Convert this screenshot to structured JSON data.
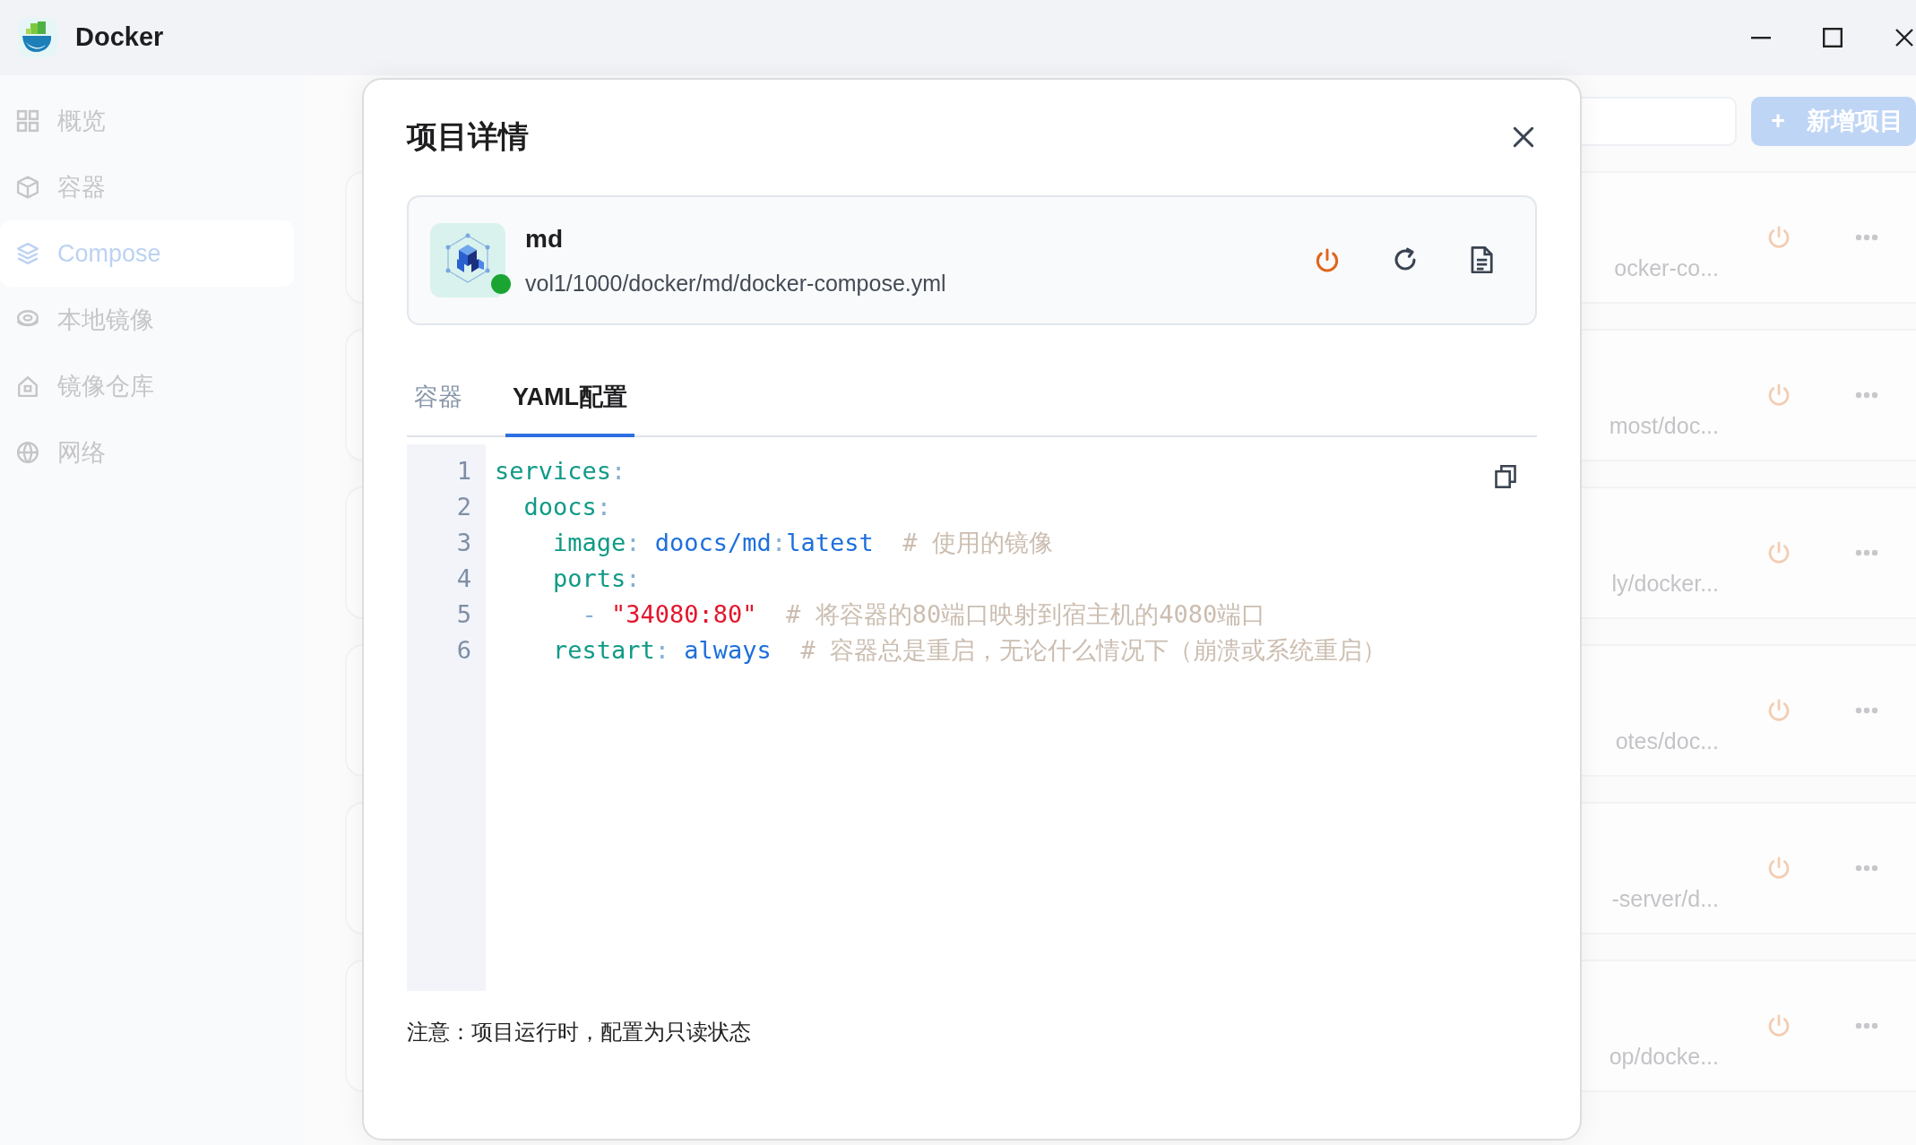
{
  "window": {
    "title": "Docker"
  },
  "sidebar": {
    "items": [
      {
        "label": "概览",
        "selected": false
      },
      {
        "label": "容器",
        "selected": false
      },
      {
        "label": "Compose",
        "selected": true
      },
      {
        "label": "本地镜像",
        "selected": false
      },
      {
        "label": "镜像仓库",
        "selected": false
      },
      {
        "label": "网络",
        "selected": false
      }
    ]
  },
  "toolbar": {
    "add_button": {
      "icon": "+",
      "label": "新增项目"
    }
  },
  "project_rows": [
    {
      "path": "ocker-co...",
      "running": false
    },
    {
      "path": "most/doc...",
      "running": false
    },
    {
      "path": "ly/docker...",
      "running": false
    },
    {
      "path": "otes/doc...",
      "running": false
    },
    {
      "path": "-server/d...",
      "running": false
    },
    {
      "path": "op/docke...",
      "running": false
    }
  ],
  "dialog": {
    "title": "项目详情",
    "project": {
      "name": "md",
      "path": "vol1/1000/docker/md/docker-compose.yml",
      "running": true
    },
    "tabs": [
      {
        "label": "容器",
        "selected": false
      },
      {
        "label": "YAML配置",
        "selected": true
      }
    ],
    "code": {
      "lines": [
        {
          "number": "1",
          "tokens": [
            {
              "kind": "key",
              "text": "services"
            },
            {
              "kind": "punct",
              "text": ":"
            }
          ]
        },
        {
          "number": "2",
          "tokens": [
            {
              "kind": "key",
              "text": "  doocs"
            },
            {
              "kind": "punct",
              "text": ":"
            }
          ]
        },
        {
          "number": "3",
          "tokens": [
            {
              "kind": "key",
              "text": "    image"
            },
            {
              "kind": "punct",
              "text": ": "
            },
            {
              "kind": "value",
              "text": "doocs/md"
            },
            {
              "kind": "punct",
              "text": ":"
            },
            {
              "kind": "value",
              "text": "latest"
            },
            {
              "kind": "comment",
              "text": "  # 使用的镜像"
            }
          ]
        },
        {
          "number": "4",
          "tokens": [
            {
              "kind": "key",
              "text": "    ports"
            },
            {
              "kind": "punct",
              "text": ":"
            }
          ]
        },
        {
          "number": "5",
          "tokens": [
            {
              "kind": "punct",
              "text": "      - "
            },
            {
              "kind": "string",
              "text": "\"34080:80\""
            },
            {
              "kind": "comment",
              "text": "  # 将容器的80端口映射到宿主机的4080端口"
            }
          ]
        },
        {
          "number": "6",
          "tokens": [
            {
              "kind": "key",
              "text": "    restart"
            },
            {
              "kind": "punct",
              "text": ": "
            },
            {
              "kind": "value",
              "text": "always"
            },
            {
              "kind": "comment",
              "text": "  # 容器总是重启，无论什么情况下（崩溃或系统重启）"
            }
          ]
        }
      ]
    },
    "note": "注意：项目运行时，配置为只读状态"
  }
}
